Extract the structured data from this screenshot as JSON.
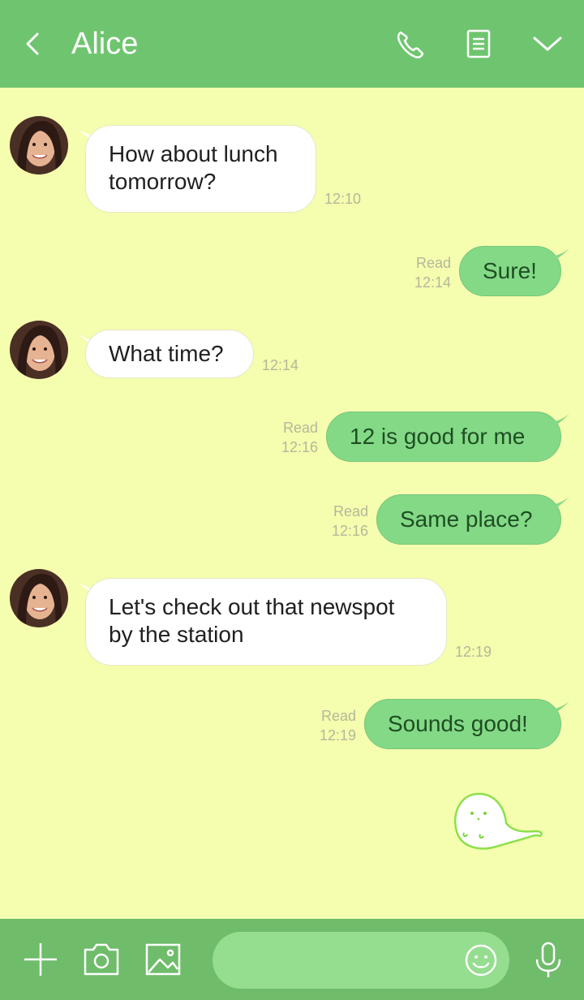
{
  "header": {
    "title": "Alice",
    "back_icon": "chevron-left-icon",
    "call_icon": "phone-icon",
    "notes_icon": "notes-icon",
    "menu_icon": "chevron-down-icon",
    "background": "#6fc56f"
  },
  "messages": [
    {
      "direction": "in",
      "lines": [
        "How about lunch",
        "tomorrow?"
      ],
      "time": "12:10"
    },
    {
      "direction": "out",
      "text": "Sure!",
      "status": "Read",
      "time": "12:14"
    },
    {
      "direction": "in",
      "lines": [
        "What time?"
      ],
      "time": "12:14"
    },
    {
      "direction": "out",
      "text": "12 is good for me",
      "status": "Read",
      "time": "12:16"
    },
    {
      "direction": "out",
      "text": "Same place?",
      "status": "Read",
      "time": "12:16"
    },
    {
      "direction": "in",
      "lines": [
        "Let's check out that newspot",
        "by the station"
      ],
      "time": "12:19"
    },
    {
      "direction": "out",
      "text": "Sounds good!",
      "status": "Read",
      "time": "12:19"
    }
  ],
  "sticker": "ghost-sticker",
  "footer": {
    "add_icon": "plus-icon",
    "camera_icon": "camera-icon",
    "image_icon": "image-icon",
    "emoji_icon": "smiley-icon",
    "mic_icon": "microphone-icon",
    "input_placeholder": ""
  },
  "colors": {
    "chat_background": "#f5fdae",
    "incoming_bubble": "#ffffff",
    "outgoing_bubble": "#84d987",
    "footer": "#6fbc6a"
  }
}
